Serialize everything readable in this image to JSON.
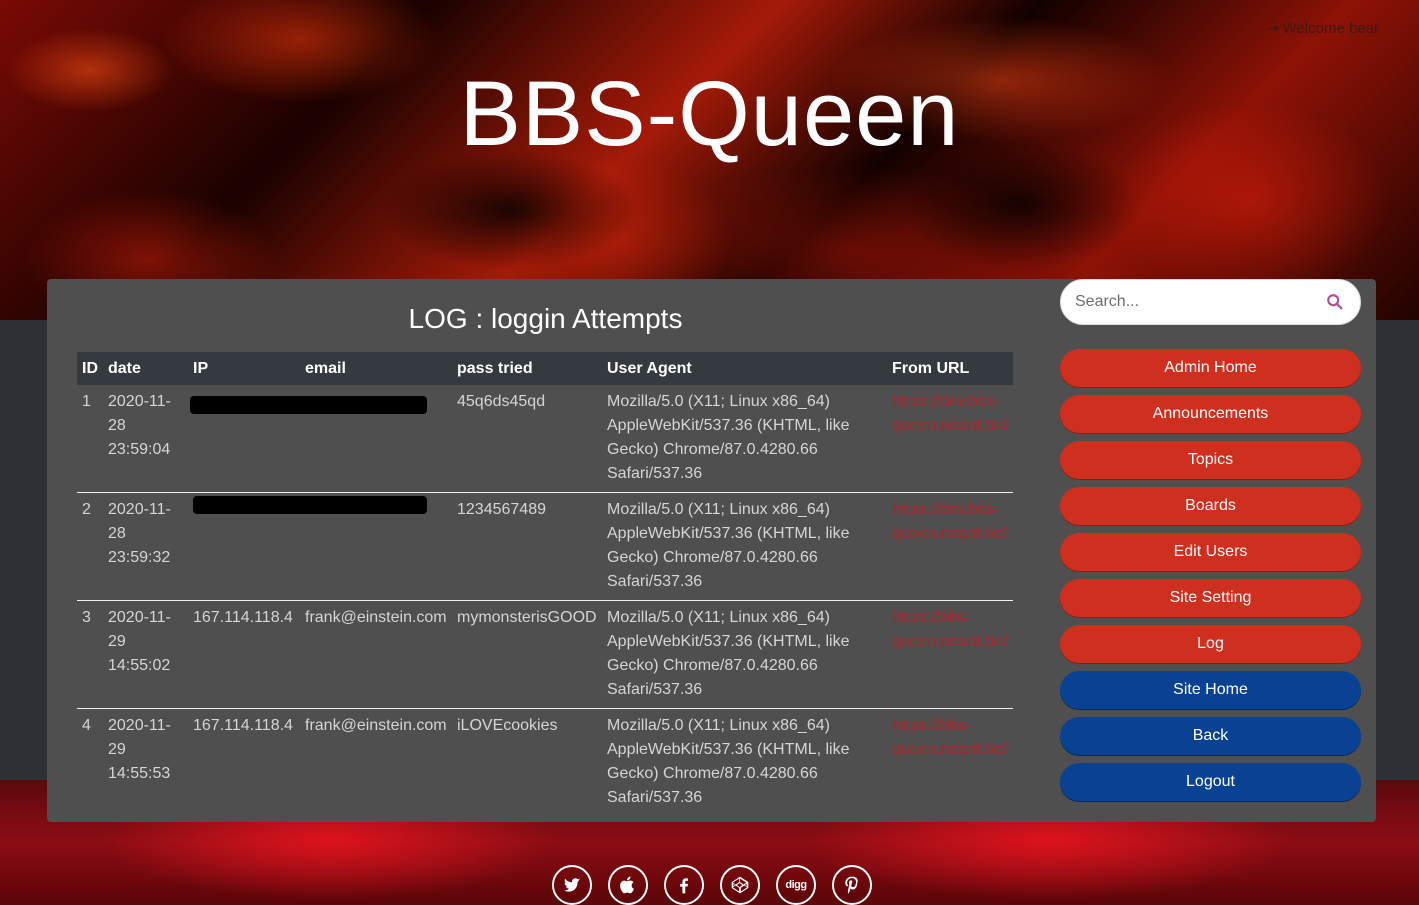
{
  "header": {
    "site_title": "BBS-Queen",
    "welcome_text": "Welcome bear",
    "login_icon": "sign-in-icon"
  },
  "log": {
    "title": "LOG : loggin Attempts",
    "columns": [
      "ID",
      "date",
      "IP",
      "email",
      "pass tried",
      "User Agent",
      "From URL"
    ],
    "rows": [
      {
        "id": "1",
        "date": [
          "2020-11-",
          "28",
          "23:59:04"
        ],
        "ip": "",
        "email": "",
        "pass": "45q6ds45qd",
        "user_agent": "Mozilla/5.0 (X11; Linux x86_64) AppleWebKit/537.36 (KHTML, like Gecko) Chrome/87.0.4280.66 Safari/537.36",
        "url": [
          "https://dev.bbs-",
          "queen.neant.be/"
        ]
      },
      {
        "id": "2",
        "date": [
          "2020-11-",
          "28",
          "23:59:32"
        ],
        "ip": "",
        "email": "",
        "pass": "1234567489",
        "user_agent": "Mozilla/5.0 (X11; Linux x86_64) AppleWebKit/537.36 (KHTML, like Gecko) Chrome/87.0.4280.66 Safari/537.36",
        "url": [
          "https://dev.bbs-",
          "queen.neant.be/"
        ]
      },
      {
        "id": "3",
        "date": [
          "2020-11-",
          "29",
          "14:55:02"
        ],
        "ip": "167.114.118.4",
        "email": "frank@einstein.com",
        "pass": "mymonsterisGOOD",
        "user_agent": "Mozilla/5.0 (X11; Linux x86_64) AppleWebKit/537.36 (KHTML, like Gecko) Chrome/87.0.4280.66 Safari/537.36",
        "url": [
          "https://bbs-",
          "queen.neant.be/"
        ]
      },
      {
        "id": "4",
        "date": [
          "2020-11-",
          "29",
          "14:55:53"
        ],
        "ip": "167.114.118.4",
        "email": "frank@einstein.com",
        "pass": "iLOVEcookies",
        "user_agent": "Mozilla/5.0 (X11; Linux x86_64) AppleWebKit/537.36 (KHTML, like Gecko) Chrome/87.0.4280.66 Safari/537.36",
        "url": [
          "https://bbs-",
          "queen.neant.be/"
        ]
      }
    ]
  },
  "sidebar": {
    "search_placeholder": "Search...",
    "search_icon": "search-icon",
    "nav": [
      {
        "label": "Admin Home",
        "color": "red"
      },
      {
        "label": "Announcements",
        "color": "red"
      },
      {
        "label": "Topics",
        "color": "red"
      },
      {
        "label": "Boards",
        "color": "red"
      },
      {
        "label": "Edit Users",
        "color": "red"
      },
      {
        "label": "Site Setting",
        "color": "red"
      },
      {
        "label": "Log",
        "color": "red"
      },
      {
        "label": "Site Home",
        "color": "blue"
      },
      {
        "label": "Back",
        "color": "blue"
      },
      {
        "label": "Logout",
        "color": "blue"
      }
    ]
  },
  "footer": {
    "social_icons": [
      "twitter-icon",
      "apple-icon",
      "facebook-icon",
      "codepen-icon",
      "digg-icon",
      "pinterest-icon"
    ],
    "digg_text": "digg"
  },
  "colors": {
    "accent_red": "#cf2f1f",
    "accent_blue": "#0a4293",
    "link_red": "#b32028",
    "panel_bg": "#4f4f50"
  }
}
